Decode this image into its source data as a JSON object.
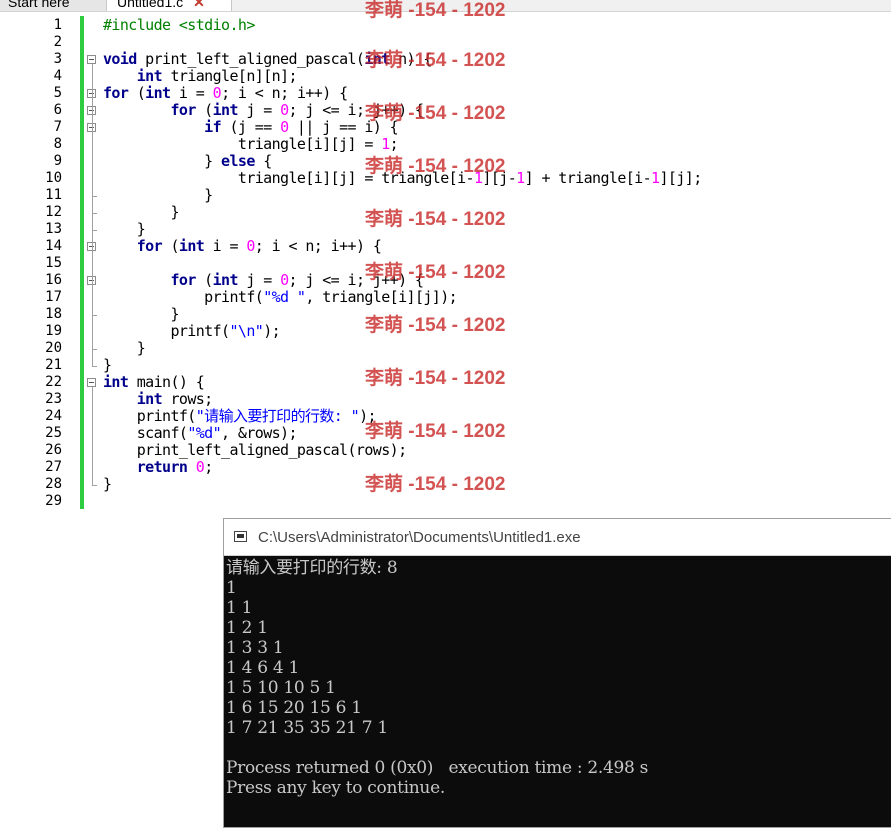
{
  "tabs": [
    {
      "label": "Start here"
    },
    {
      "label": "Untitled1.c",
      "close": "✕"
    }
  ],
  "code_lines": [
    [
      {
        "t": "#include <stdio.h>",
        "c": "pre"
      }
    ],
    [],
    [
      {
        "t": "void",
        "c": "kw"
      },
      {
        "t": " print_left_aligned_pascal("
      },
      {
        "t": "int",
        "c": "kw"
      },
      {
        "t": " n) {"
      }
    ],
    [
      {
        "t": "    "
      },
      {
        "t": "int",
        "c": "kw"
      },
      {
        "t": " triangle[n][n];"
      }
    ],
    [
      {
        "t": "for",
        "c": "kw"
      },
      {
        "t": " ("
      },
      {
        "t": "int",
        "c": "kw"
      },
      {
        "t": " i = "
      },
      {
        "t": "0",
        "c": "num"
      },
      {
        "t": "; i < n; i++) {"
      }
    ],
    [
      {
        "t": "        "
      },
      {
        "t": "for",
        "c": "kw"
      },
      {
        "t": " ("
      },
      {
        "t": "int",
        "c": "kw"
      },
      {
        "t": " j = "
      },
      {
        "t": "0",
        "c": "num"
      },
      {
        "t": "; j <= i; j++) {"
      }
    ],
    [
      {
        "t": "            "
      },
      {
        "t": "if",
        "c": "kw"
      },
      {
        "t": " (j == "
      },
      {
        "t": "0",
        "c": "num"
      },
      {
        "t": " || j == i) {"
      }
    ],
    [
      {
        "t": "                triangle[i][j] = "
      },
      {
        "t": "1",
        "c": "num"
      },
      {
        "t": ";"
      }
    ],
    [
      {
        "t": "            } "
      },
      {
        "t": "else",
        "c": "kw"
      },
      {
        "t": " {"
      }
    ],
    [
      {
        "t": "                triangle[i][j] = triangle[i-"
      },
      {
        "t": "1",
        "c": "num"
      },
      {
        "t": "][j-"
      },
      {
        "t": "1",
        "c": "num"
      },
      {
        "t": "] + triangle[i-"
      },
      {
        "t": "1",
        "c": "num"
      },
      {
        "t": "][j];"
      }
    ],
    [
      {
        "t": "            }"
      }
    ],
    [
      {
        "t": "        }"
      }
    ],
    [
      {
        "t": "    }"
      }
    ],
    [
      {
        "t": "    "
      },
      {
        "t": "for",
        "c": "kw"
      },
      {
        "t": " ("
      },
      {
        "t": "int",
        "c": "kw"
      },
      {
        "t": " i = "
      },
      {
        "t": "0",
        "c": "num"
      },
      {
        "t": "; i < n; i++) {"
      }
    ],
    [],
    [
      {
        "t": "        "
      },
      {
        "t": "for",
        "c": "kw"
      },
      {
        "t": " ("
      },
      {
        "t": "int",
        "c": "kw"
      },
      {
        "t": " j = "
      },
      {
        "t": "0",
        "c": "num"
      },
      {
        "t": "; j <= i; j++) {"
      }
    ],
    [
      {
        "t": "            printf("
      },
      {
        "t": "\"%d \"",
        "c": "str"
      },
      {
        "t": ", triangle[i][j]);"
      }
    ],
    [
      {
        "t": "        }"
      }
    ],
    [
      {
        "t": "        printf("
      },
      {
        "t": "\"\\n\"",
        "c": "str"
      },
      {
        "t": ");"
      }
    ],
    [
      {
        "t": "    }"
      }
    ],
    [
      {
        "t": "}"
      }
    ],
    [
      {
        "t": "int",
        "c": "kw"
      },
      {
        "t": " main() {"
      }
    ],
    [
      {
        "t": "    "
      },
      {
        "t": "int",
        "c": "kw"
      },
      {
        "t": " rows;"
      }
    ],
    [
      {
        "t": "    printf("
      },
      {
        "t": "\"请输入要打印的行数: \"",
        "c": "str"
      },
      {
        "t": ");"
      }
    ],
    [
      {
        "t": "    scanf("
      },
      {
        "t": "\"%d\"",
        "c": "str"
      },
      {
        "t": ", &rows);"
      }
    ],
    [
      {
        "t": "    print_left_aligned_pascal(rows);"
      }
    ],
    [
      {
        "t": "    "
      },
      {
        "t": "return",
        "c": "kw"
      },
      {
        "t": " "
      },
      {
        "t": "0",
        "c": "num"
      },
      {
        "t": ";"
      }
    ],
    [
      {
        "t": "}"
      }
    ],
    []
  ],
  "line_numbers": [
    "1",
    "2",
    "3",
    "4",
    "5",
    "6",
    "7",
    "8",
    "9",
    "10",
    "11",
    "12",
    "13",
    "14",
    "15",
    "16",
    "17",
    "18",
    "19",
    "20",
    "21",
    "22",
    "23",
    "24",
    "25",
    "26",
    "27",
    "28",
    "29"
  ],
  "fold_markers_at_lines": [
    3,
    5,
    6,
    7,
    14,
    16,
    22
  ],
  "watermark": "李萌 -154 - 1202",
  "console": {
    "title": "C:\\Users\\Administrator\\Documents\\Untitled1.exe",
    "lines": [
      "请输入要打印的行数: 8",
      "1",
      "1 1",
      "1 2 1",
      "1 3 3 1",
      "1 4 6 4 1",
      "1 5 10 10 5 1",
      "1 6 15 20 15 6 1",
      "1 7 21 35 35 21 7 1",
      "",
      "Process returned 0 (0x0)   execution time : 2.498 s",
      "Press any key to continue."
    ]
  },
  "colors": {
    "keyword": "#00008b",
    "number": "#ff00ff",
    "string": "#0000ff",
    "preprocessor": "#008000",
    "change_bar": "#2ecc40",
    "watermark": "#c82828"
  }
}
